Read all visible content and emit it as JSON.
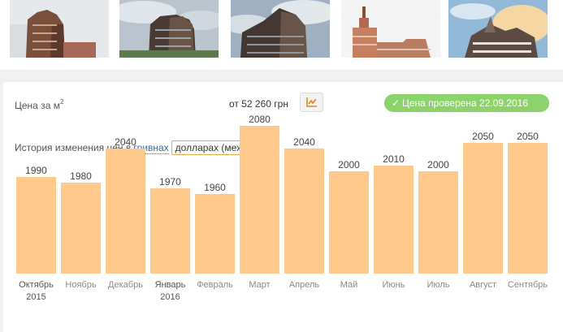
{
  "gallery": {
    "photos": [
      "building-photo-1",
      "building-photo-2",
      "building-photo-3",
      "building-photo-4",
      "building-photo-5"
    ]
  },
  "price": {
    "label": "Цена за м",
    "unit_sup": "2",
    "from_text": "от 52 260 грн",
    "chart_button_icon": "line-chart-icon"
  },
  "verified": {
    "icon": "check-icon",
    "text": "Цена проверена 22.09.2016",
    "color": "#8bd36a"
  },
  "history": {
    "label": "История изменения цен в",
    "link_uah": "гривнах",
    "selected_currency": "долларах (межбанк)"
  },
  "chart_data": {
    "type": "bar",
    "categories": [
      "Октябрь",
      "Ноябрь",
      "Декабрь",
      "Январь",
      "Февраль",
      "Март",
      "Апрель",
      "Май",
      "Июнь",
      "Июль",
      "Август",
      "Сентябрь"
    ],
    "years": {
      "0": "2015",
      "3": "2016"
    },
    "values": [
      1990,
      1980,
      2040,
      1970,
      1960,
      2080,
      2040,
      2000,
      2010,
      2000,
      2050,
      2050
    ],
    "data_labels": [
      "1990",
      "1980",
      "2040",
      "1970",
      "1960",
      "2080",
      "2040",
      "2000",
      "2010",
      "2000",
      "2050",
      "2050"
    ],
    "bar_color": "#fec98a"
  }
}
